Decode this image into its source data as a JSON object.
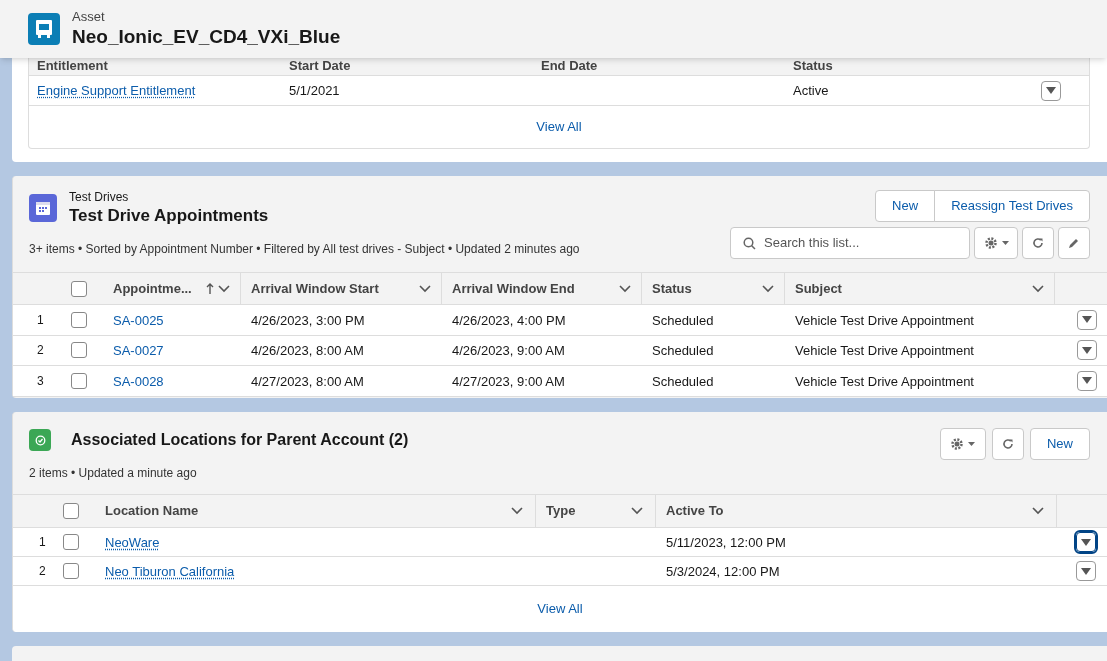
{
  "header": {
    "object_type": "Asset",
    "title": "Neo_Ionic_EV_CD4_VXi_Blue"
  },
  "entitlements": {
    "columns": [
      "Entitlement",
      "Start Date",
      "End Date",
      "Status"
    ],
    "rows": [
      {
        "cells": [
          "Engine Support Entitlement",
          "5/1/2021",
          "",
          "Active"
        ]
      }
    ],
    "view_all": "View All"
  },
  "test_drives": {
    "object_type": "Test Drives",
    "title": "Test Drive Appointments",
    "buttons": [
      "New",
      "Reassign Test Drives"
    ],
    "meta": "3+ items • Sorted by Appointment Number • Filtered by All test drives - Subject • Updated 2 minutes ago",
    "search": {
      "placeholder": "Search this list..."
    },
    "all_checked": false,
    "columns": [
      {
        "label": "Appointme...",
        "sorted": true
      },
      {
        "label": "Arrival Window Start",
        "sorted": false
      },
      {
        "label": "Arrival Window End",
        "sorted": false
      },
      {
        "label": "Status",
        "sorted": false
      },
      {
        "label": "Subject",
        "sorted": false
      }
    ],
    "rows": [
      {
        "number": "1",
        "checked": false,
        "cells": [
          "SA-0025",
          "4/26/2023, 3:00 PM",
          "4/26/2023, 4:00 PM",
          "Scheduled",
          "Vehicle Test Drive Appointment"
        ]
      },
      {
        "number": "2",
        "checked": false,
        "cells": [
          "SA-0027",
          "4/26/2023, 8:00 AM",
          "4/26/2023, 9:00 AM",
          "Scheduled",
          "Vehicle Test Drive Appointment"
        ]
      },
      {
        "number": "3",
        "checked": false,
        "cells": [
          "SA-0028",
          "4/27/2023, 8:00 AM",
          "4/27/2023, 9:00 AM",
          "Scheduled",
          "Vehicle Test Drive Appointment"
        ]
      }
    ]
  },
  "locations": {
    "title": "Associated Locations for Parent Account (2)",
    "buttons": [
      "New"
    ],
    "meta": "2 items • Updated a minute ago",
    "all_checked": false,
    "columns": [
      {
        "label": "Location Name"
      },
      {
        "label": "Type"
      },
      {
        "label": "Active To"
      }
    ],
    "rows": [
      {
        "number": "1",
        "checked": false,
        "focused": true,
        "cells": [
          "NeoWare",
          "",
          "5/11/2023, 12:00 PM"
        ]
      },
      {
        "number": "2",
        "checked": false,
        "focused": false,
        "cells": [
          "Neo Tiburon California",
          "",
          "5/3/2024, 12:00 PM"
        ]
      }
    ],
    "view_all": "View All"
  }
}
